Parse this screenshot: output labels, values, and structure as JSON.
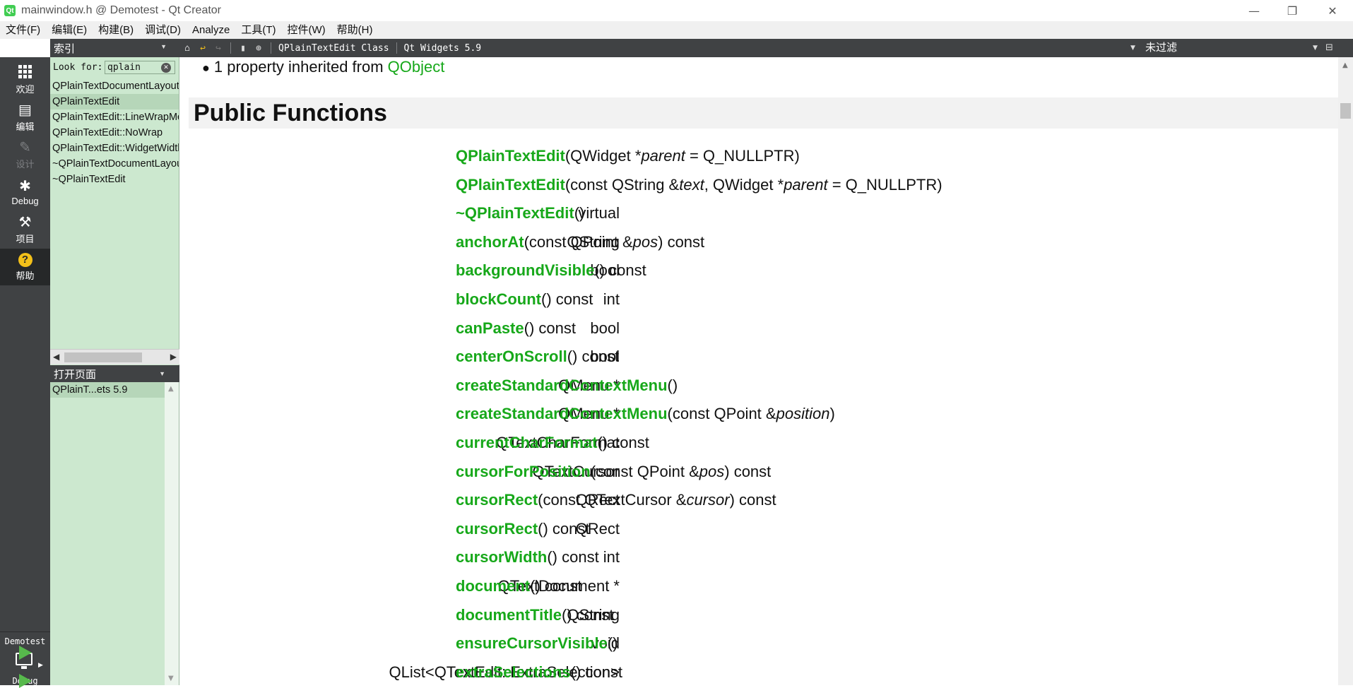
{
  "window": {
    "title": "mainwindow.h @ Demotest - Qt Creator",
    "app_icon": "Qt",
    "controls": {
      "minimize": "—",
      "restore": "❐",
      "close": "✕"
    }
  },
  "menubar": [
    "文件(F)",
    "编辑(E)",
    "构建(B)",
    "调试(D)",
    "Analyze",
    "工具(T)",
    "控件(W)",
    "帮助(H)"
  ],
  "modes": [
    {
      "label": "欢迎",
      "icon": "grid-icon",
      "state": "normal"
    },
    {
      "label": "编辑",
      "icon": "document-icon",
      "state": "normal"
    },
    {
      "label": "设计",
      "icon": "pencil-icon",
      "state": "disabled"
    },
    {
      "label": "Debug",
      "icon": "bug-icon",
      "state": "normal"
    },
    {
      "label": "项目",
      "icon": "wrench-icon",
      "state": "normal"
    },
    {
      "label": "帮助",
      "icon": "help-icon",
      "state": "active",
      "glyph": "?"
    }
  ],
  "kit": {
    "project": "Demotest",
    "build": "Debug"
  },
  "sidebar": {
    "header": "索引",
    "lookfor_label": "Look for:",
    "search_value": "qplain",
    "items": [
      "QPlainTextDocumentLayout",
      "QPlainTextEdit",
      "QPlainTextEdit::LineWrapMode",
      "QPlainTextEdit::NoWrap",
      "QPlainTextEdit::WidgetWidth",
      "~QPlainTextDocumentLayout",
      "~QPlainTextEdit"
    ],
    "selected_index": 1
  },
  "open_pages": {
    "header": "打开页面",
    "items": [
      "QPlainT...ets 5.9"
    ]
  },
  "doc_toolbar": {
    "crumb_class": "QPlainTextEdit Class",
    "crumb_module": "Qt Widgets 5.9",
    "filter": "未过滤"
  },
  "doc": {
    "inherit_text": "1 property inherited from ",
    "inherit_link": "QObject",
    "section": "Public Functions",
    "functions": [
      {
        "type": "",
        "name": "QPlainTextEdit",
        "sig": [
          [
            "t",
            "("
          ],
          [
            "t",
            "QWidget *"
          ],
          [
            "a",
            "parent"
          ],
          [
            "t",
            " = Q_NULLPTR)"
          ]
        ]
      },
      {
        "type": "",
        "name": "QPlainTextEdit",
        "sig": [
          [
            "t",
            "(const QString &"
          ],
          [
            "a",
            "text"
          ],
          [
            "t",
            ", QWidget *"
          ],
          [
            "a",
            "parent"
          ],
          [
            "t",
            " = Q_NULLPTR)"
          ]
        ]
      },
      {
        "type": "virtual",
        "name": "~QPlainTextEdit",
        "sig": [
          [
            "t",
            "()"
          ]
        ]
      },
      {
        "type": "QString",
        "name": "anchorAt",
        "sig": [
          [
            "t",
            "(const QPoint &"
          ],
          [
            "a",
            "pos"
          ],
          [
            "t",
            ") const"
          ]
        ]
      },
      {
        "type": "bool",
        "name": "backgroundVisible",
        "sig": [
          [
            "t",
            "() const"
          ]
        ]
      },
      {
        "type": "int",
        "name": "blockCount",
        "sig": [
          [
            "t",
            "() const"
          ]
        ]
      },
      {
        "type": "bool",
        "name": "canPaste",
        "sig": [
          [
            "t",
            "() const"
          ]
        ]
      },
      {
        "type": "bool",
        "name": "centerOnScroll",
        "sig": [
          [
            "t",
            "() const"
          ]
        ]
      },
      {
        "type": "QMenu *",
        "name": "createStandardContextMenu",
        "sig": [
          [
            "t",
            "()"
          ]
        ]
      },
      {
        "type": "QMenu *",
        "name": "createStandardContextMenu",
        "sig": [
          [
            "t",
            "(const QPoint &"
          ],
          [
            "a",
            "position"
          ],
          [
            "t",
            ")"
          ]
        ]
      },
      {
        "type": "QTextCharFormat",
        "name": "currentCharFormat",
        "sig": [
          [
            "t",
            "() const"
          ]
        ]
      },
      {
        "type": "QTextCursor",
        "name": "cursorForPosition",
        "sig": [
          [
            "t",
            "(const QPoint &"
          ],
          [
            "a",
            "pos"
          ],
          [
            "t",
            ") const"
          ]
        ]
      },
      {
        "type": "QRect",
        "name": "cursorRect",
        "sig": [
          [
            "t",
            "(const QTextCursor &"
          ],
          [
            "a",
            "cursor"
          ],
          [
            "t",
            ") const"
          ]
        ]
      },
      {
        "type": "QRect",
        "name": "cursorRect",
        "sig": [
          [
            "t",
            "() const"
          ]
        ]
      },
      {
        "type": "int",
        "name": "cursorWidth",
        "sig": [
          [
            "t",
            "() const"
          ]
        ]
      },
      {
        "type": "QTextDocument *",
        "name": "document",
        "sig": [
          [
            "t",
            "() const"
          ]
        ]
      },
      {
        "type": "QString",
        "name": "documentTitle",
        "sig": [
          [
            "t",
            "() const"
          ]
        ]
      },
      {
        "type": "void",
        "name": "ensureCursorVisible",
        "sig": [
          [
            "t",
            "()"
          ]
        ]
      },
      {
        "type": "QList<QTextEdit::ExtraSelection>",
        "name": "extraSelections",
        "sig": [
          [
            "t",
            "() const"
          ]
        ]
      }
    ]
  },
  "colors": {
    "link_green": "#17a81a",
    "sidebar_bg": "#cce8cf",
    "modebar_bg": "#404244",
    "help_yellow": "#f3c019",
    "run_green": "#57b94c"
  }
}
